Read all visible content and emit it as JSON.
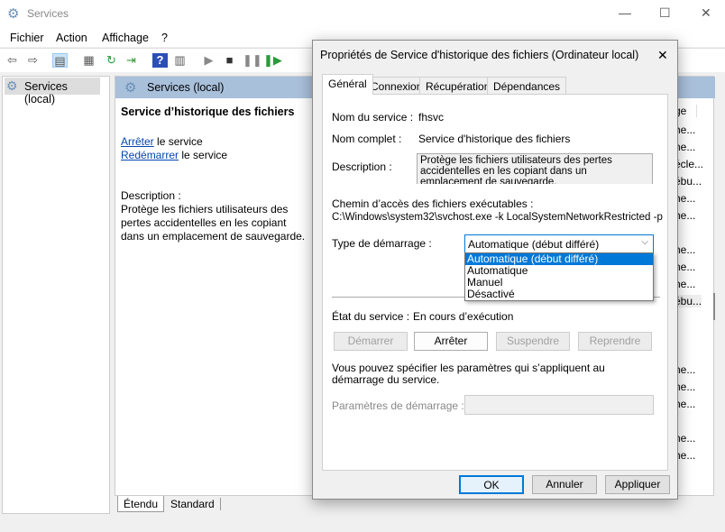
{
  "window": {
    "title": "Services"
  },
  "menu": [
    "Fichier",
    "Action",
    "Affichage",
    "?"
  ],
  "tree": {
    "root": "Services (local)"
  },
  "main": {
    "header": "Services (local)",
    "service_name": "Service d’historique des fichiers",
    "stop_link": "Arrêter",
    "stop_suffix": " le service",
    "restart_link": "Redémarrer",
    "restart_suffix": " le service",
    "description_label": "Description :",
    "description": "Protège les fichiers utilisateurs des pertes accidentelles en les copiant dans un emplacement de sauvegarde.",
    "column_header": "ge",
    "column_cells": [
      "he...",
      "he...",
      "écle...",
      "ébu...",
      "he...",
      "he...",
      "",
      "he...",
      "he...",
      "he...",
      "ébu...",
      "",
      "",
      "",
      "he...",
      "he...",
      "he...",
      "",
      "he...",
      "he..."
    ]
  },
  "bottom_tabs": [
    "Étendu",
    "Standard"
  ],
  "dialog": {
    "title": "Propriétés de Service d'historique des fichiers (Ordinateur local)",
    "tabs": [
      "Général",
      "Connexion",
      "Récupération",
      "Dépendances"
    ],
    "service_name_label": "Nom du service :",
    "service_name": "fhsvc",
    "display_name_label": "Nom complet :",
    "display_name": "Service d'historique des fichiers",
    "description_label": "Description :",
    "description": "Protège les fichiers utilisateurs des pertes accidentelles en les copiant dans un emplacement de sauvegarde.",
    "path_label": "Chemin d’accès des fichiers exécutables :",
    "path": "C:\\Windows\\system32\\svchost.exe -k LocalSystemNetworkRestricted -p",
    "startup_label": "Type de démarrage :",
    "startup_value": "Automatique (début différé)",
    "startup_options": [
      "Automatique (début différé)",
      "Automatique",
      "Manuel",
      "Désactivé"
    ],
    "status_label": "État du service :",
    "status": "En cours d’exécution",
    "btn_start": "Démarrer",
    "btn_stop": "Arrêter",
    "btn_pause": "Suspendre",
    "btn_resume": "Reprendre",
    "params_hint": "Vous pouvez spécifier les paramètres qui s’appliquent au démarrage du service.",
    "params_label": "Paramètres de démarrage :",
    "params_value": "",
    "ok": "OK",
    "cancel": "Annuler",
    "apply": "Appliquer"
  }
}
